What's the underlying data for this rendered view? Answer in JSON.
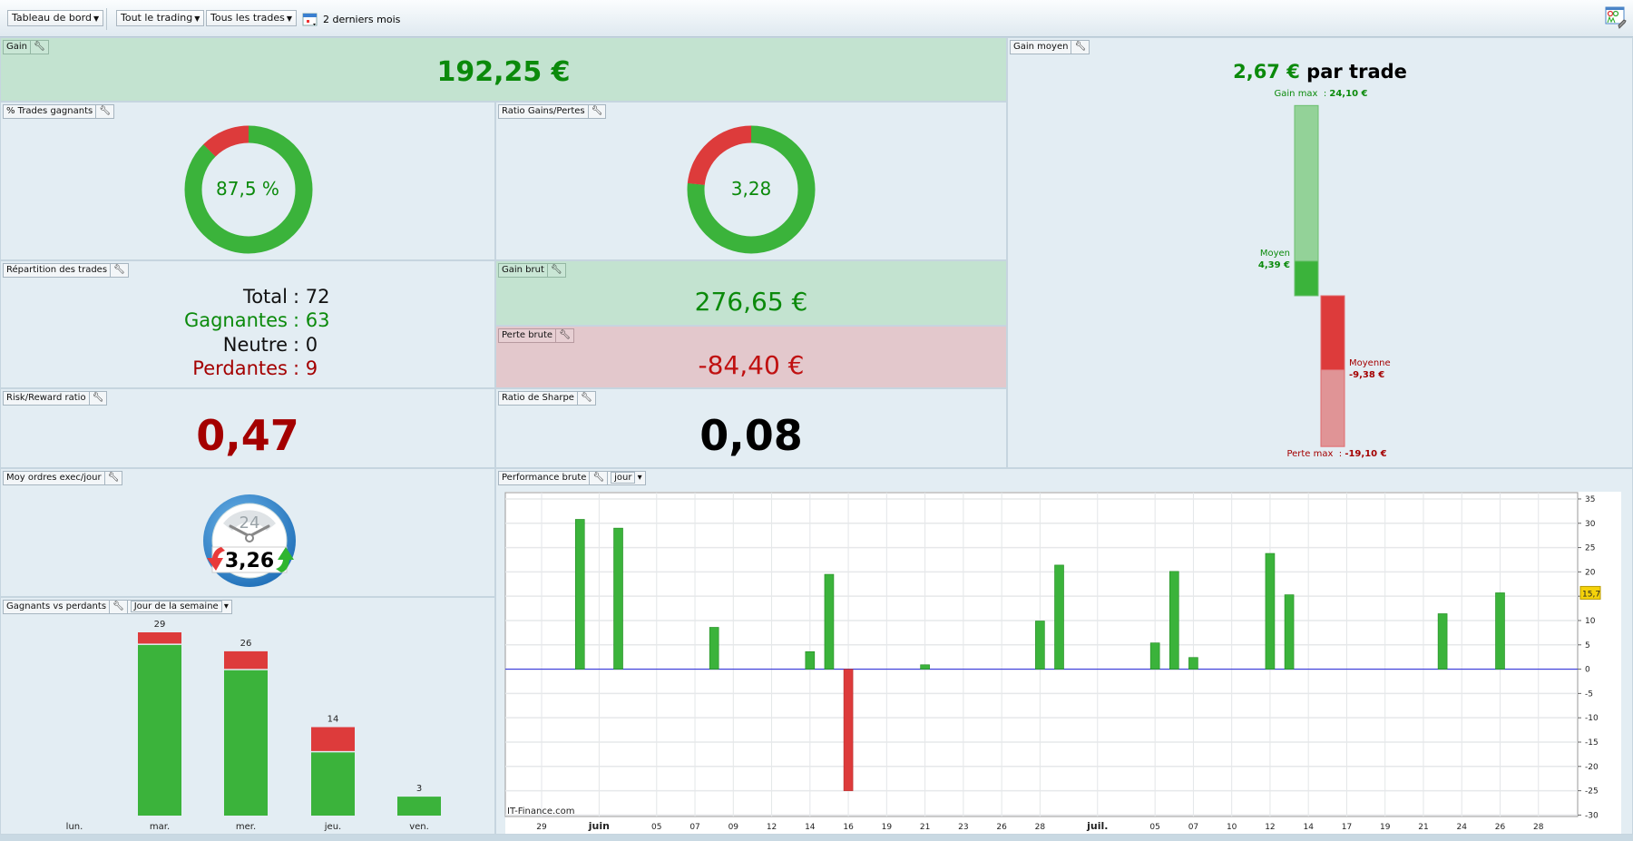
{
  "toolbar": {
    "dashboard": "Tableau de bord",
    "trading": "Tout le trading",
    "trades": "Tous les trades",
    "period": "2 derniers mois",
    "period_icon": "calendar-icon",
    "settings_icon": "dashboard-settings-icon"
  },
  "colors": {
    "gain": "#0b8a0b",
    "loss": "#a40000",
    "bar_green": "#3bb33b",
    "bar_red": "#dd3b3b",
    "panel": "#e3edf3",
    "panel_green": "#c3e3d0",
    "panel_red": "#e3c8cc"
  },
  "panels": {
    "gain": {
      "title": "Gain",
      "value": "192,25 €"
    },
    "win_pct": {
      "title": "% Trades gagnants",
      "value": "87,5 %",
      "win_fraction": 0.875
    },
    "ratio": {
      "title": "Ratio Gains/Pertes",
      "value": "3,28",
      "gain_fraction": 0.766
    },
    "repartition": {
      "title": "Répartition des trades",
      "rows": [
        {
          "label": "Total",
          "value": ": 72"
        },
        {
          "label": "Gagnantes",
          "value": ": 63"
        },
        {
          "label": "Neutre",
          "value": ": 0"
        },
        {
          "label": "Perdantes",
          "value": ": 9"
        }
      ]
    },
    "gain_brut": {
      "title": "Gain brut",
      "value": "276,65 €"
    },
    "perte_brute": {
      "title": "Perte brute",
      "value": "-84,40 €"
    },
    "risk_reward": {
      "title": "Risk/Reward ratio",
      "value": "0,47"
    },
    "sharpe": {
      "title": "Ratio de Sharpe",
      "value": "0,08"
    },
    "gain_moyen": {
      "title": "Gain moyen",
      "value": "2,67 €",
      "suffix": "par trade",
      "gain_max_label": "Gain max",
      "gain_max_value": "24,10 €",
      "moyen_label": "Moyen",
      "moyen_value": "4,39 €",
      "moyenne_label": "Moyenne",
      "moyenne_value": "-9,38 €",
      "perte_max_label": "Perte max",
      "perte_max_value": "-19,10 €",
      "levels": {
        "gain_max": 24.1,
        "avg_gain": 4.39,
        "avg_loss": -9.38,
        "max_loss": -19.1
      }
    },
    "ordres": {
      "title": "Moy ordres exec/jour",
      "value": "3,26",
      "clock_label": "24"
    },
    "weekday": {
      "title": "Gagnants vs perdants",
      "mode": "Jour de la semaine"
    },
    "perf": {
      "title": "Performance brute",
      "mode": "jour",
      "watermark": "IT-Finance.com",
      "last_value_label": "15,7"
    }
  },
  "chart_data": [
    {
      "type": "bar",
      "stacked": true,
      "categories": [
        "lun.",
        "mar.",
        "mer.",
        "jeu.",
        "ven."
      ],
      "totals": [
        "",
        "29",
        "26",
        "14",
        "3"
      ],
      "series": [
        {
          "values": [
            0,
            27,
            23,
            10,
            3
          ],
          "color": "#3bb33b"
        },
        {
          "values": [
            0,
            2,
            3,
            4,
            0
          ],
          "color": "#dd3b3b"
        }
      ],
      "ylim": [
        0,
        29
      ]
    },
    {
      "type": "bar",
      "x_ticks": [
        "29",
        "juin",
        "05",
        "07",
        "09",
        "12",
        "14",
        "16",
        "19",
        "21",
        "23",
        "26",
        "28",
        "juil.",
        "05",
        "07",
        "10",
        "12",
        "14",
        "17",
        "19",
        "21",
        "24",
        "26",
        "28"
      ],
      "y_ticks": [
        "35",
        "30",
        "25",
        "20",
        "15",
        "10",
        "5",
        "0",
        "-5",
        "-10",
        "-15",
        "-20",
        "-25",
        "-30"
      ],
      "ylim": [
        -30.3,
        36.3
      ],
      "grid": true,
      "bars": [
        {
          "x": "31/05",
          "y": 30.8
        },
        {
          "x": "02/06",
          "y": 29.0
        },
        {
          "x": "08/06",
          "y": 8.6
        },
        {
          "x": "14/06",
          "y": 3.6
        },
        {
          "x": "15/06",
          "y": 19.5
        },
        {
          "x": "16/06",
          "y": -25.0
        },
        {
          "x": "21/06",
          "y": 0.9
        },
        {
          "x": "28/06",
          "y": 9.9
        },
        {
          "x": "29/06",
          "y": 21.4
        },
        {
          "x": "05/07",
          "y": 5.4
        },
        {
          "x": "06/07",
          "y": 20.1
        },
        {
          "x": "07/07",
          "y": 2.4
        },
        {
          "x": "12/07",
          "y": 23.8
        },
        {
          "x": "13/07",
          "y": 15.3
        },
        {
          "x": "22/07",
          "y": 11.4
        },
        {
          "x": "26/07",
          "y": 15.7
        }
      ]
    }
  ]
}
